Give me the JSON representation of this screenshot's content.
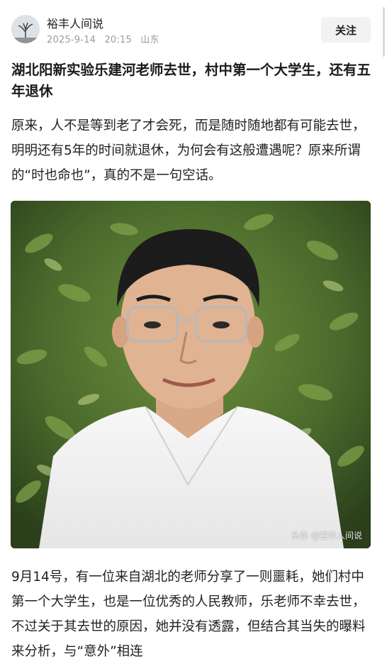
{
  "header": {
    "author": "裕丰人间说",
    "date": "2025-9-14",
    "time": "20:15",
    "location": "山东",
    "follow_label": "关注"
  },
  "article": {
    "title": "湖北阳新实验乐建河老师去世，村中第一个大学生，还有五年退休",
    "intro": "原来，人不是等到老了才会死，而是随时随地都有可能去世，明明还有5年的时间就退休，为何会有这般遭遇呢？原来所谓的“时也命也”，真的不是一句空话。",
    "image_watermark": "头条 @裕丰人间说",
    "body": "9月14号，有一位来自湖北的老师分享了一则噩耗，她们村中第一个大学生，也是一位优秀的人民教师，乐老师不幸去世，不过关于其去世的原因，她并没有透露，但结合其当失的曝料来分析，与“意外”相连"
  }
}
